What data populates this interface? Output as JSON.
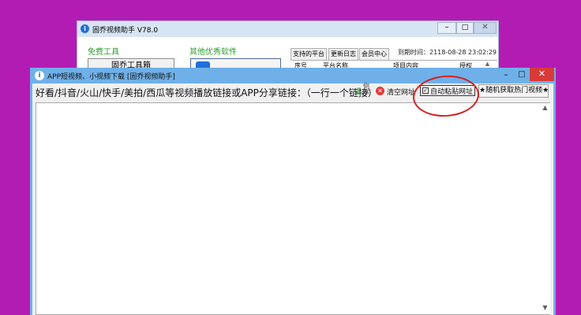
{
  "background_window": {
    "title": "固乔视频助手 V78.0",
    "icon_letter": "i",
    "controls": {
      "minimize": "–",
      "maximize": "□",
      "close": "✕"
    },
    "free_tools_label": "免费工具",
    "other_software_label": "其他优秀软件",
    "toolbox_button_label": "固乔工具箱",
    "tabs": [
      "支持的平台",
      "更新日志",
      "会员中心"
    ],
    "expire_text": "到期时间：2118-08-28 23:02:29",
    "table_headers": [
      "序号",
      "平台名称",
      "项目内容",
      "授权"
    ],
    "scroll_up": "▲"
  },
  "main_window": {
    "title": "APP短视频、小视频下载 [固乔视频助手]",
    "icon_letter": "i",
    "controls": {
      "minimize": "–",
      "maximize": "□",
      "close": "✕"
    },
    "toolbar": {
      "instruction": "好看/抖音/火山/快手/美拍/西瓜等视频播放链接或APP分享链接：（一行一个链接）",
      "reverse_arrow": "⇓",
      "reverse_label": "倒序",
      "clear_icon": "✕",
      "clear_label": "清空网址",
      "autopaste_check": "✓",
      "autopaste_label": "自动粘贴网址",
      "random_hot_label": "★随机获取热门视频★"
    },
    "textarea": {
      "value": "",
      "scroll_up": "▲",
      "scroll_down": "▼"
    }
  },
  "colors": {
    "desktop": "#b31cb3",
    "main_frame": "#6fb0e8",
    "annotation": "#d42222",
    "label_green": "#2e9b2e"
  }
}
